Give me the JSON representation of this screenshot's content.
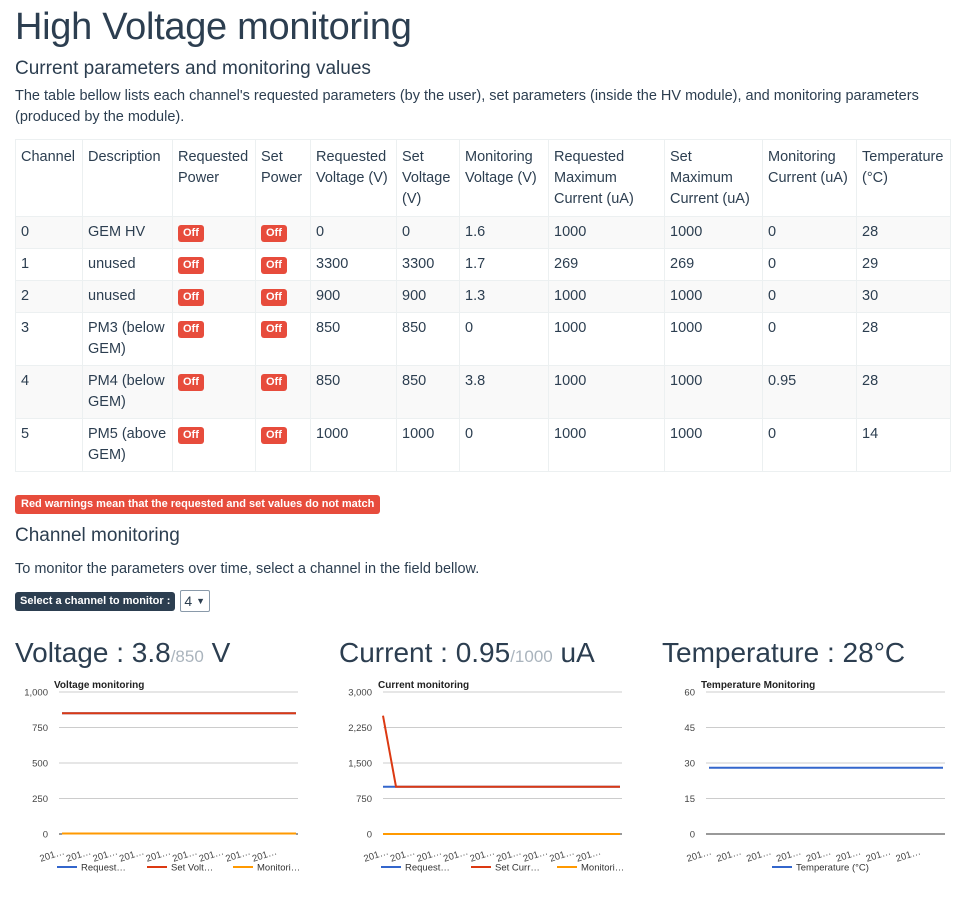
{
  "page": {
    "title": "High Voltage monitoring",
    "subtitle": "Current parameters and monitoring values",
    "description": "The table bellow lists each channel's requested parameters (by the user), set parameters (inside the HV module), and monitoring parameters (produced by the module)."
  },
  "table": {
    "headers": [
      "Channel",
      "Description",
      "Requested Power",
      "Set Power",
      "Requested Voltage (V)",
      "Set Voltage (V)",
      "Monitoring Voltage (V)",
      "Requested Maximum Current (uA)",
      "Set Maximum Current (uA)",
      "Monitoring Current (uA)",
      "Temperature (°C)"
    ],
    "rows": [
      [
        "0",
        "GEM HV",
        "Off",
        "Off",
        "0",
        "0",
        "1.6",
        "1000",
        "1000",
        "0",
        "28"
      ],
      [
        "1",
        "unused",
        "Off",
        "Off",
        "3300",
        "3300",
        "1.7",
        "269",
        "269",
        "0",
        "29"
      ],
      [
        "2",
        "unused",
        "Off",
        "Off",
        "900",
        "900",
        "1.3",
        "1000",
        "1000",
        "0",
        "30"
      ],
      [
        "3",
        "PM3 (below GEM)",
        "Off",
        "Off",
        "850",
        "850",
        "0",
        "1000",
        "1000",
        "0",
        "28"
      ],
      [
        "4",
        "PM4 (below GEM)",
        "Off",
        "Off",
        "850",
        "850",
        "3.8",
        "1000",
        "1000",
        "0.95",
        "28"
      ],
      [
        "5",
        "PM5 (above GEM)",
        "Off",
        "Off",
        "1000",
        "1000",
        "0",
        "1000",
        "1000",
        "0",
        "14"
      ]
    ]
  },
  "warning": "Red warnings mean that the requested and set values do not match",
  "monitoring": {
    "title": "Channel monitoring",
    "description": "To monitor the parameters over time, select a channel in the field bellow.",
    "select_label": "Select a channel to monitor :",
    "selected_channel": "4"
  },
  "panels": {
    "voltage": {
      "label": "Voltage : ",
      "value": "3.8",
      "limit": "/850",
      "unit": " V"
    },
    "current": {
      "label": "Current : ",
      "value": "0.95",
      "limit": "/1000",
      "unit": " uA"
    },
    "temperature": {
      "label": "Temperature : ",
      "value": "28",
      "unit": "°C"
    }
  },
  "colors": {
    "blue": "#3366cc",
    "red": "#dc3912",
    "orange": "#ff9900",
    "danger": "#e74c3c",
    "dark": "#2c3e50"
  },
  "chart_data": [
    {
      "type": "line",
      "title": "Voltage monitoring",
      "ylim": [
        0,
        1000
      ],
      "yticks": [
        "0",
        "250",
        "500",
        "750",
        "1,000"
      ],
      "xticks": [
        "201…",
        "201…",
        "201…",
        "201…",
        "201…",
        "201…",
        "201…",
        "201…",
        "201…"
      ],
      "series": [
        {
          "name": "Request…",
          "color": "#3366cc",
          "values": [
            850,
            850
          ]
        },
        {
          "name": "Set Volt…",
          "color": "#dc3912",
          "values": [
            850,
            850
          ]
        },
        {
          "name": "Monitori…",
          "color": "#ff9900",
          "values": [
            3.8,
            3.8
          ]
        }
      ]
    },
    {
      "type": "line",
      "title": "Current monitoring",
      "ylim": [
        0,
        3000
      ],
      "yticks": [
        "0",
        "750",
        "1,500",
        "2,250",
        "3,000"
      ],
      "xticks": [
        "201…",
        "201…",
        "201…",
        "201…",
        "201…",
        "201…",
        "201…",
        "201…",
        "201…"
      ],
      "series": [
        {
          "name": "Request…",
          "color": "#3366cc",
          "values": [
            1000,
            1000,
            1000
          ]
        },
        {
          "name": "Set Curr…",
          "color": "#dc3912",
          "values": [
            2500,
            1000,
            1000
          ]
        },
        {
          "name": "Monitori…",
          "color": "#ff9900",
          "values": [
            0.95,
            0.95,
            0.95
          ]
        }
      ]
    },
    {
      "type": "line",
      "title": "Temperature Monitoring",
      "ylim": [
        0,
        60
      ],
      "yticks": [
        "0",
        "15",
        "30",
        "45",
        "60"
      ],
      "xticks": [
        "201…",
        "201…",
        "201…",
        "201…",
        "201…",
        "201…",
        "201…",
        "201…"
      ],
      "series": [
        {
          "name": "Temperature (°C)",
          "color": "#3366cc",
          "values": [
            28,
            28
          ]
        }
      ]
    }
  ]
}
